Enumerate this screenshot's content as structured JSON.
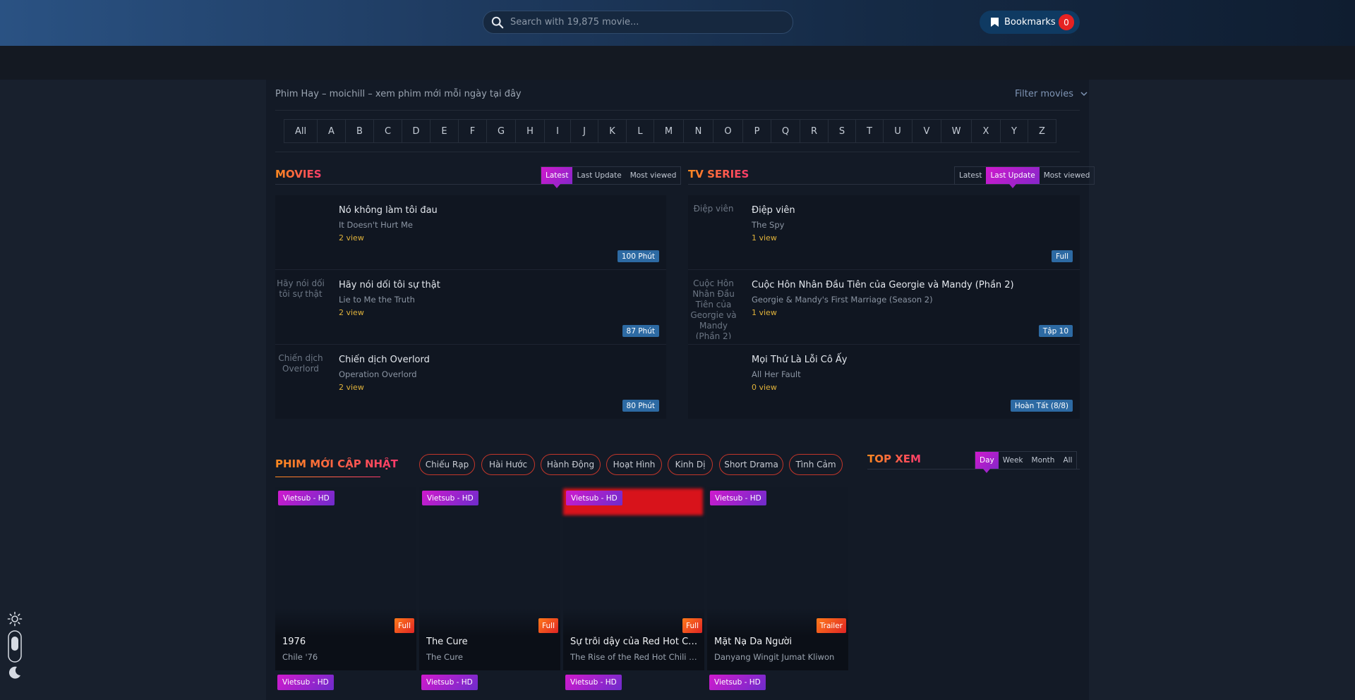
{
  "header": {
    "search_placeholder": "Search with 19,875 movie...",
    "bookmarks_label": "Bookmarks",
    "bookmarks_count": "0"
  },
  "page": {
    "tagline": "Phim Hay – moichill – xem phim mới mỗi ngày tại đây",
    "filter_label": "Filter movies"
  },
  "alphabet": [
    "All",
    "A",
    "B",
    "C",
    "D",
    "E",
    "F",
    "G",
    "H",
    "I",
    "J",
    "K",
    "L",
    "M",
    "N",
    "O",
    "P",
    "Q",
    "R",
    "S",
    "T",
    "U",
    "V",
    "W",
    "X",
    "Y",
    "Z"
  ],
  "movies": {
    "title": "MOVIES",
    "tabs": [
      "Latest",
      "Last Update",
      "Most viewed"
    ],
    "active_tab": "Latest",
    "items": [
      {
        "title": "Nó không làm tôi đau",
        "original": "It Doesn't Hurt Me",
        "views": "2 view",
        "badge": "100 Phút",
        "thumb_alt": ""
      },
      {
        "title": "Hãy nói dối tôi sự thật",
        "original": "Lie to Me the Truth",
        "views": "2 view",
        "badge": "87 Phút",
        "thumb_alt": "Hãy nói dối tôi sự thật"
      },
      {
        "title": "Chiến dịch Overlord",
        "original": "Operation Overlord",
        "views": "2 view",
        "badge": "80 Phút",
        "thumb_alt": "Chiến dịch Overlord"
      }
    ]
  },
  "tv_series": {
    "title": "TV SERIES",
    "tabs": [
      "Latest",
      "Last Update",
      "Most viewed"
    ],
    "active_tab": "Last Update",
    "items": [
      {
        "title": "Điệp viên",
        "original": "The Spy",
        "views": "1 view",
        "badge": "Full",
        "thumb_alt": "Điệp viên"
      },
      {
        "title": "Cuộc Hôn Nhân Đầu Tiên của Georgie và Mandy (Phần 2)",
        "original": "Georgie & Mandy's First Marriage (Season 2)",
        "views": "1 view",
        "badge": "Tập 10",
        "thumb_alt": "Cuộc Hôn Nhân Đầu Tiên của Georgie và Mandy (Phần 2)"
      },
      {
        "title": "Mọi Thứ Là Lỗi Cô Ấy",
        "original": "All Her Fault",
        "views": "0 view",
        "badge": "Hoàn Tất (8/8)",
        "thumb_alt": ""
      }
    ]
  },
  "new_updates": {
    "title": "PHIM MỚI CẬP NHẬT",
    "genres": [
      "Chiếu Rạp",
      "Hài Hước",
      "Hành Động",
      "Hoạt Hình",
      "Kinh Dị",
      "Short Drama",
      "Tình Cảm"
    ],
    "cards": [
      {
        "tag": "Vietsub - HD",
        "state": "Full",
        "title": "1976",
        "original": "Chile '76"
      },
      {
        "tag": "Vietsub - HD",
        "state": "Full",
        "title": "The Cure",
        "original": "The Cure"
      },
      {
        "tag": "Vietsub - HD",
        "state": "Full",
        "title": "Sự trỗi dậy của Red Hot Chili Peppers",
        "original": "The Rise of the Red Hot Chili Peppers"
      },
      {
        "tag": "Vietsub - HD",
        "state": "Trailer",
        "title": "Mặt Nạ Da Người",
        "original": "Danyang Wingit Jumat Kliwon"
      }
    ],
    "next_row_tags": [
      "Vietsub - HD",
      "Vietsub - HD",
      "Vietsub - HD",
      "Vietsub - HD"
    ]
  },
  "top_views": {
    "title": "TOP XEM",
    "tabs": [
      "Day",
      "Week",
      "Month",
      "All"
    ],
    "active_tab": "Day"
  },
  "icons": {
    "search": "search-icon",
    "bookmark": "bookmark-icon",
    "sun": "sun-icon",
    "moon": "moon-icon",
    "toggle": "theme-toggle",
    "chevron": "chevron-down-icon"
  },
  "colors": {
    "accent_gradient_start": "#d01acd",
    "accent_gradient_end": "#8626c9",
    "title_gradient_start": "#ff8a1f",
    "title_gradient_end": "#ff3b6b",
    "badge_blue": "#2d6aa3",
    "view_yellow": "#e0b23b",
    "bookmark_count_red": "#e52222"
  }
}
